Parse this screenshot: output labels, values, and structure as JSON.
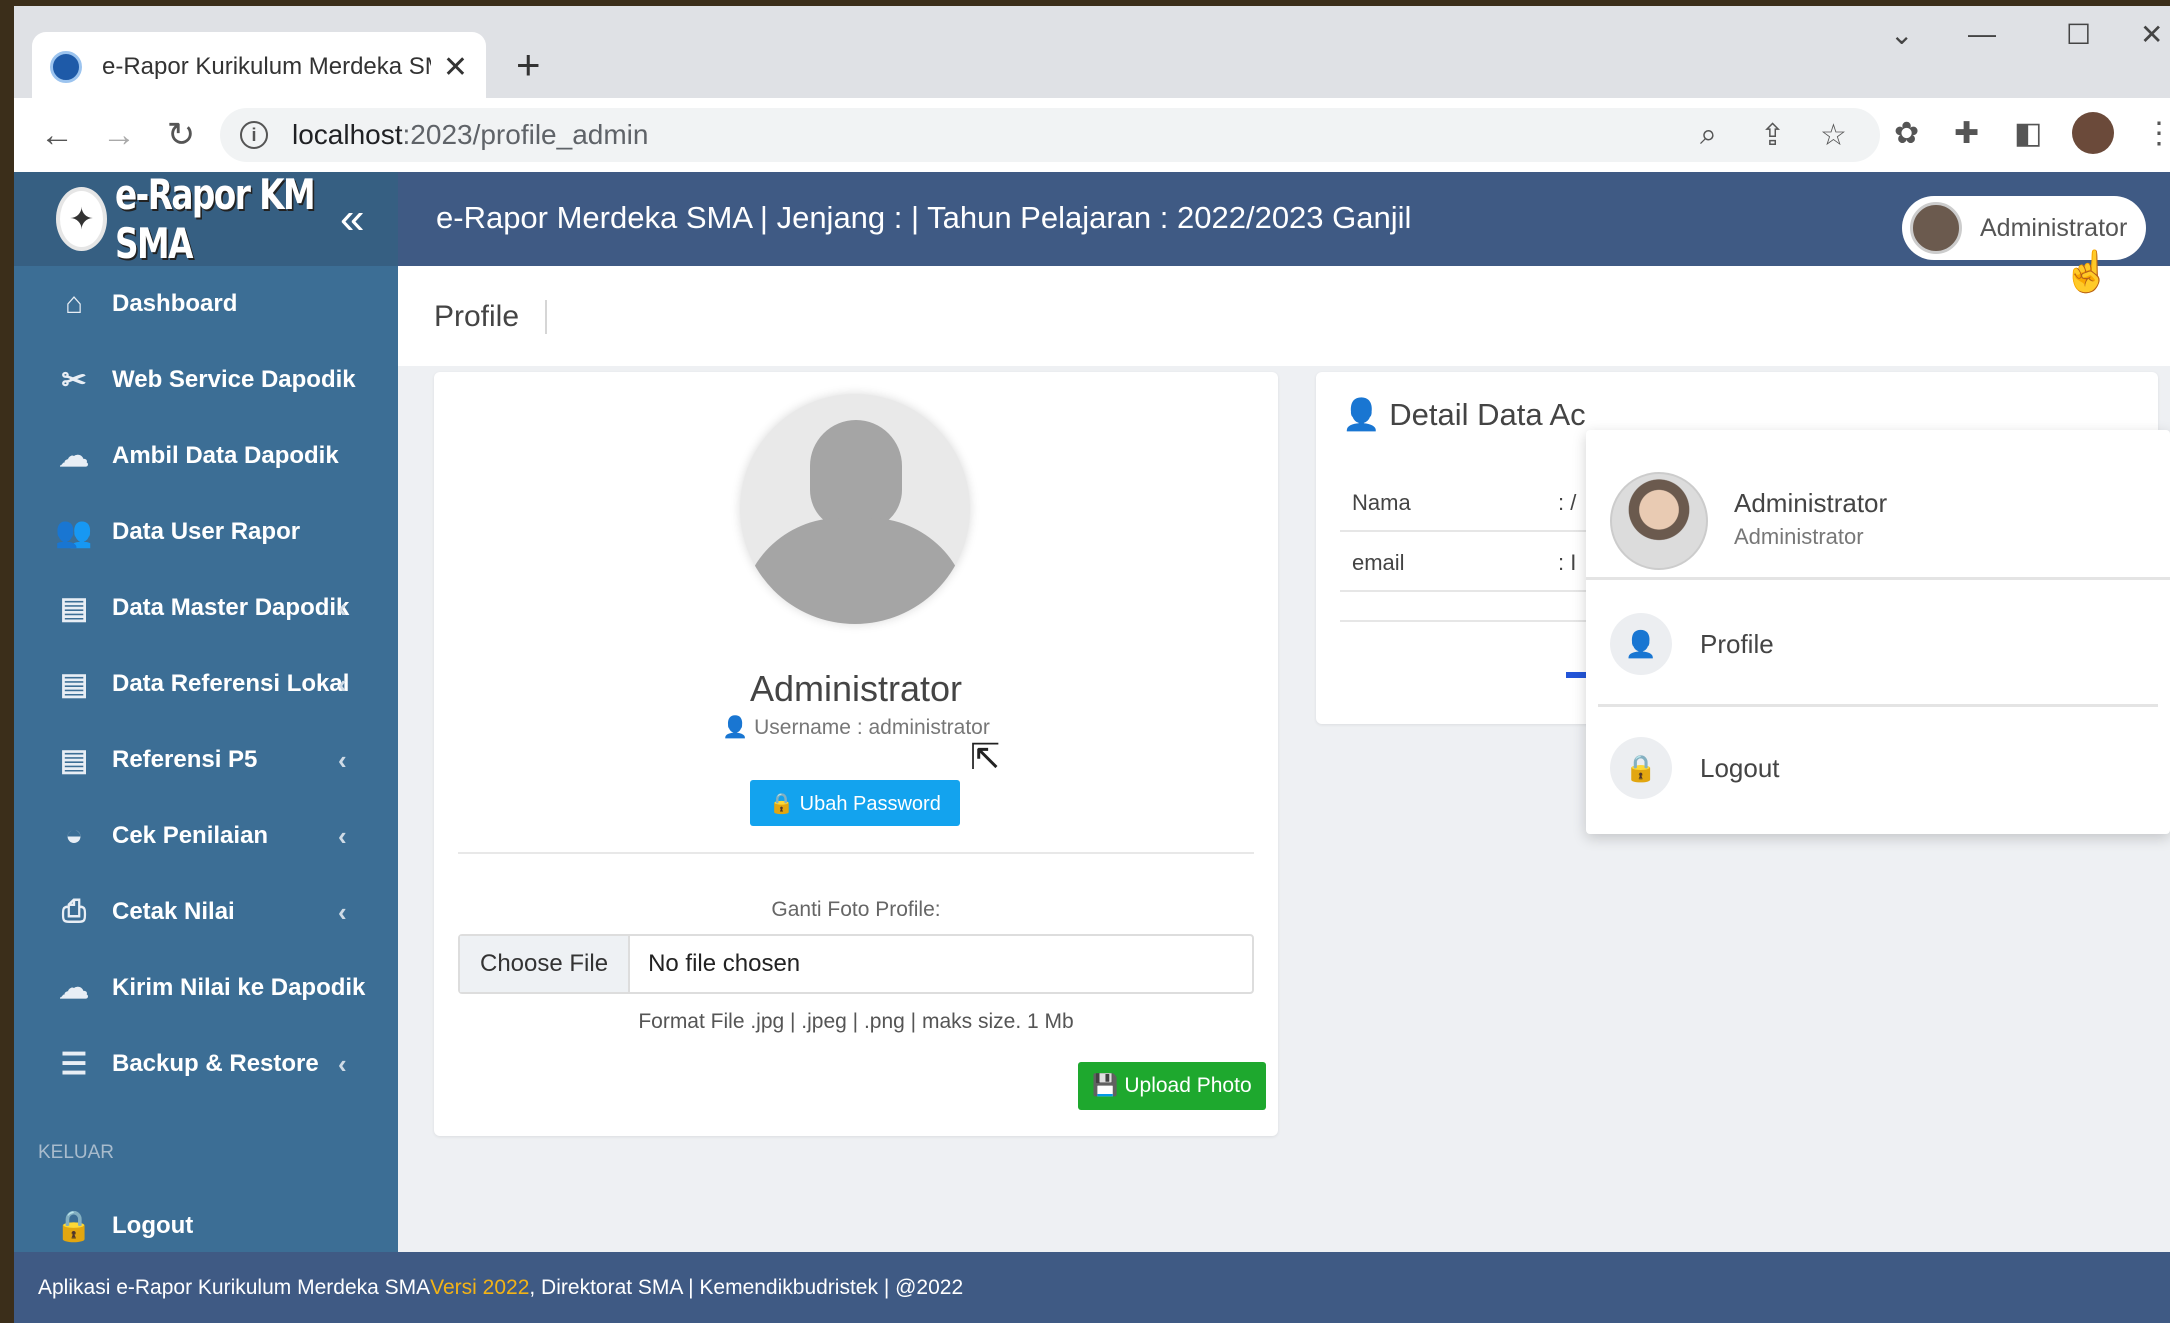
{
  "browser": {
    "tab_title": "e-Rapor Kurikulum Merdeka SMA",
    "url_host": "localhost",
    "url_path": ":2023/profile_admin"
  },
  "sidebar": {
    "brand": "e-Rapor KM SMA",
    "items": [
      {
        "label": "Dashboard",
        "icon": "home-icon",
        "glyph": "⌂"
      },
      {
        "label": "Web Service Dapodik",
        "icon": "tools-icon",
        "glyph": "✂"
      },
      {
        "label": "Ambil Data Dapodik",
        "icon": "cloud-download-icon",
        "glyph": "☁"
      },
      {
        "label": "Data User Rapor",
        "icon": "users-icon",
        "glyph": "👥"
      },
      {
        "label": "Data Master Dapodik",
        "icon": "inbox-icon",
        "glyph": "▤"
      },
      {
        "label": "Data Referensi Lokal",
        "icon": "inbox-icon",
        "glyph": "▤"
      },
      {
        "label": "Referensi P5",
        "icon": "inbox-icon",
        "glyph": "▤"
      },
      {
        "label": "Cek Penilaian",
        "icon": "gauge-icon",
        "glyph": "◒"
      },
      {
        "label": "Cetak Nilai",
        "icon": "printer-icon",
        "glyph": "⎙"
      },
      {
        "label": "Kirim Nilai ke Dapodik",
        "icon": "cloud-upload-icon",
        "glyph": "☁"
      },
      {
        "label": "Backup & Restore",
        "icon": "database-icon",
        "glyph": "☰"
      }
    ],
    "section_keluar": "KELUAR",
    "logout_label": "Logout"
  },
  "topnav": {
    "title": "e-Rapor Merdeka SMA | Jenjang : | Tahun Pelajaran : 2022/2023 Ganjil",
    "user_name": "Administrator"
  },
  "page": {
    "title": "Profile"
  },
  "profile_card": {
    "name": "Administrator",
    "username_text": "Username : administrator",
    "ubah_password": "Ubah Password",
    "ganti_foto_label": "Ganti Foto Profile:",
    "choose_file": "Choose File",
    "no_file": "No file chosen",
    "format_note": "Format File .jpg | .jpeg | .png | maks size. 1 Mb",
    "upload_photo": "Upload Photo"
  },
  "detail_card": {
    "title": "Detail Data Ac",
    "rows": [
      {
        "label": "Nama",
        "colon": ": /"
      },
      {
        "label": "email",
        "colon": ": I"
      }
    ]
  },
  "dropdown": {
    "name": "Administrator",
    "role": "Administrator",
    "profile_label": "Profile",
    "logout_label": "Logout"
  },
  "footer": {
    "prefix": "Aplikasi e-Rapor Kurikulum Merdeka SMA ",
    "version": "Versi 2022",
    "suffix": ", Direktorat SMA | Kemendikbudristek | @2022"
  },
  "colors": {
    "sidebar": "#3c6e95",
    "topnav": "#3f5a84",
    "btn_info": "#13a3ee",
    "btn_success": "#1ea82e",
    "version_accent": "#f3b316"
  }
}
